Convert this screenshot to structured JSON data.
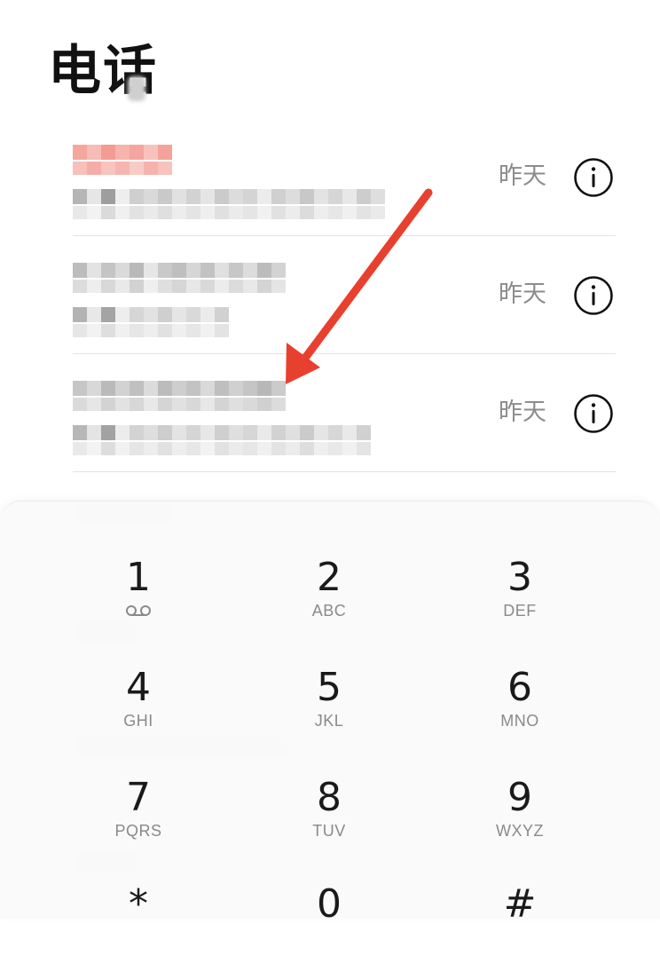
{
  "header": {
    "title": "电话"
  },
  "recent_calls": [
    {
      "time": "昨天"
    },
    {
      "time": "昨天"
    },
    {
      "time": "昨天"
    }
  ],
  "dialpad": {
    "keys": [
      {
        "digit": "1",
        "letters": ""
      },
      {
        "digit": "2",
        "letters": "ABC"
      },
      {
        "digit": "3",
        "letters": "DEF"
      },
      {
        "digit": "4",
        "letters": "GHI"
      },
      {
        "digit": "5",
        "letters": "JKL"
      },
      {
        "digit": "6",
        "letters": "MNO"
      },
      {
        "digit": "7",
        "letters": "PQRS"
      },
      {
        "digit": "8",
        "letters": "TUV"
      },
      {
        "digit": "9",
        "letters": "WXYZ"
      },
      {
        "digit": "*",
        "letters": ""
      },
      {
        "digit": "0",
        "letters": ""
      },
      {
        "digit": "#",
        "letters": ""
      }
    ]
  },
  "colors": {
    "annotation_arrow": "#e8402f",
    "redacted_highlight": "#f08c84",
    "secondary_text": "#8c8c8c"
  },
  "icons": {
    "info": "info-circle-icon",
    "voicemail": "voicemail-icon"
  }
}
